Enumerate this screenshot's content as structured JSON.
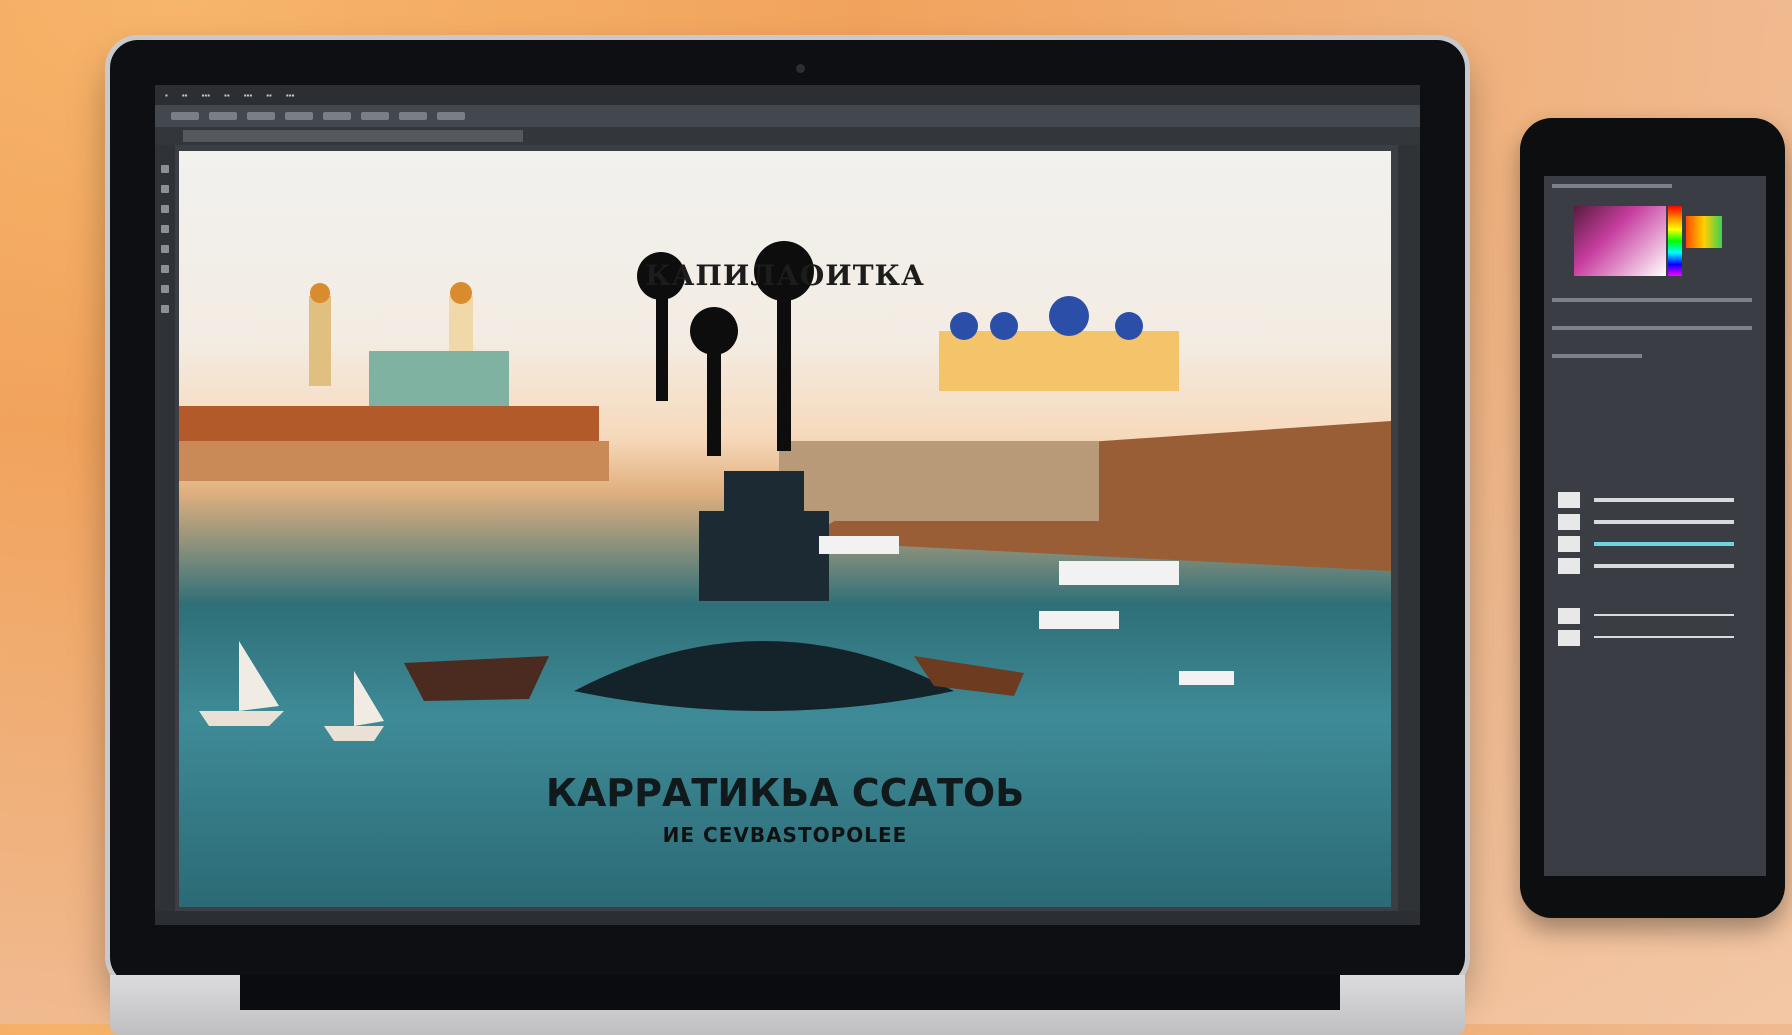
{
  "canvas": {
    "top_title": "КАПИЛАОИТКА",
    "main_title": "КАРРАТИКЬА ССАТОЬ",
    "subtitle": "ИЕ CEVBASTOPOLEE"
  }
}
